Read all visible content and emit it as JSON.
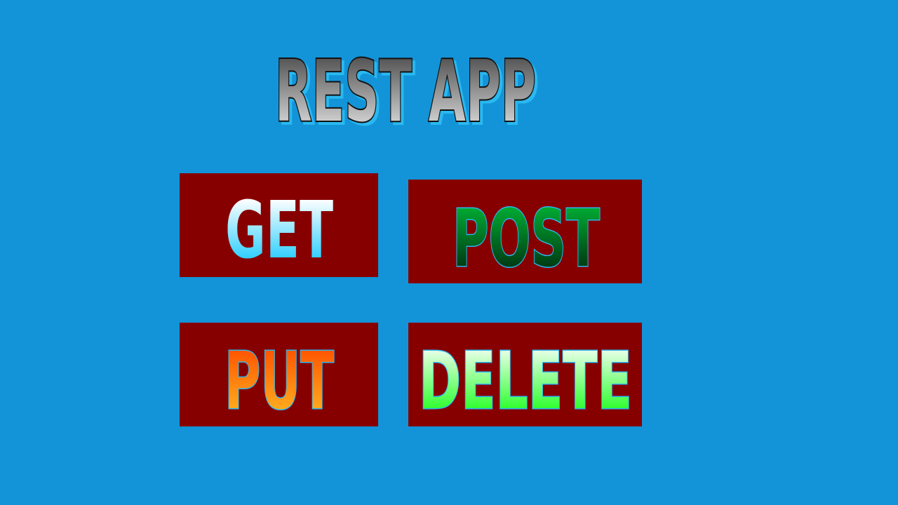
{
  "app": {
    "title": "REST APP"
  },
  "buttons": {
    "get": {
      "label": "GET"
    },
    "post": {
      "label": "POST"
    },
    "put": {
      "label": "PUT"
    },
    "delete": {
      "label": "DELETE"
    }
  },
  "colors": {
    "background": "#1394d8",
    "button_background": "#870000",
    "title_gradient_top": "#3a3a3a",
    "title_gradient_bottom": "#f2f2f2",
    "get_gradient_top": "#ffffff",
    "get_gradient_bottom": "#22ccff",
    "post_gradient_top": "#00aa33",
    "post_gradient_bottom": "#003311",
    "put_gradient_top": "#ff5500",
    "put_gradient_bottom": "#ffb020",
    "delete_gradient_top": "#e8ffe8",
    "delete_gradient_bottom": "#22ff22",
    "text_outline": "#2ab8f0"
  }
}
